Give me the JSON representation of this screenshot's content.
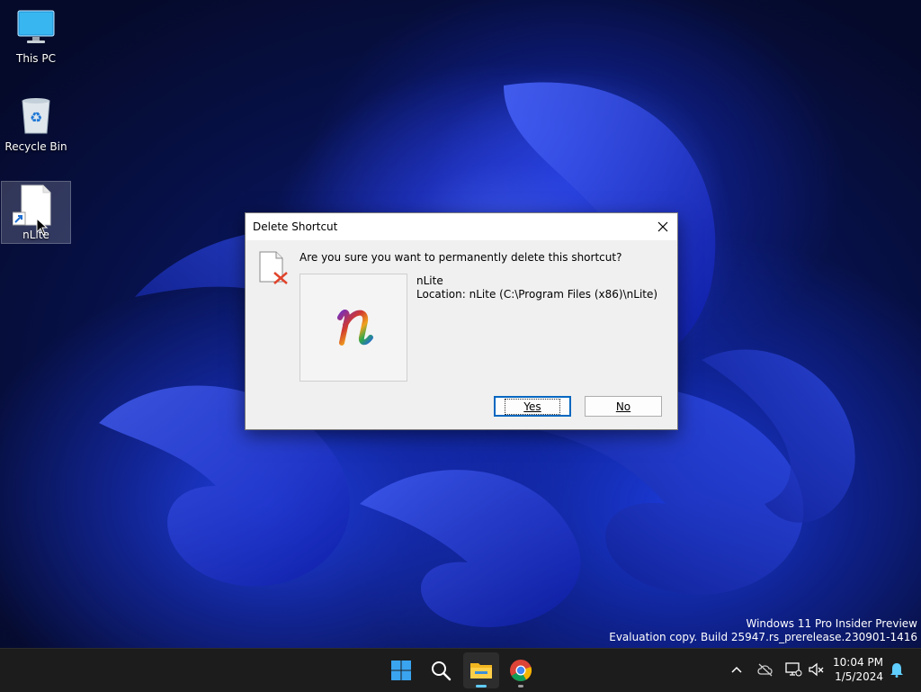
{
  "desktop": {
    "icons": [
      {
        "label": "This PC",
        "icon": "monitor-icon"
      },
      {
        "label": "Recycle Bin",
        "icon": "recycle-bin-icon"
      },
      {
        "label": "nLite",
        "icon": "shortcut-file-icon"
      }
    ],
    "watermark": {
      "line1": "Windows 11 Pro Insider Preview",
      "line2": "Evaluation copy. Build 25947.rs_prerelease.230901-1416"
    }
  },
  "dialog": {
    "title": "Delete Shortcut",
    "question": "Are you sure you want to permanently delete this shortcut?",
    "item_name": "nLite",
    "item_location": "Location: nLite (C:\\Program Files (x86)\\nLite)",
    "yes_label": "Yes",
    "no_label": "No",
    "close_icon": "close-icon",
    "warning_icon": "delete-file-icon"
  },
  "taskbar": {
    "apps": [
      {
        "name": "Start",
        "icon": "windows-start-icon"
      },
      {
        "name": "Search",
        "icon": "search-icon"
      },
      {
        "name": "File Explorer",
        "icon": "folder-icon",
        "active": true
      },
      {
        "name": "Google Chrome",
        "icon": "chrome-icon",
        "running": true
      }
    ],
    "tray": {
      "chevron_icon": "chevron-up-icon",
      "cloud_icon": "cloud-offline-icon",
      "network_icon": "network-icon",
      "volume_icon": "volume-muted-icon",
      "notification_icon": "bell-icon"
    },
    "clock": {
      "time": "10:04 PM",
      "date": "1/5/2024"
    }
  },
  "colors": {
    "accent": "#0067c0",
    "taskbar_bg": "#1c1c1c",
    "dialog_bg": "#f0f0f0"
  }
}
